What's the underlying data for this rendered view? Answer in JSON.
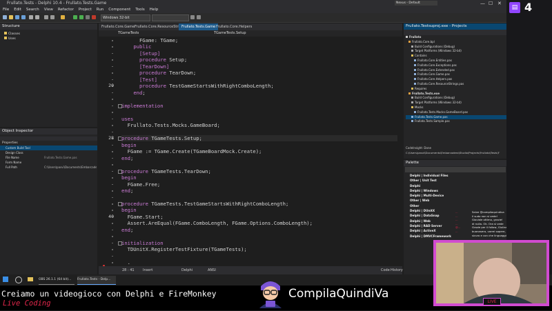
{
  "window": {
    "title": "Frullato.Tests - Delphi 10.4 - Frullato.Tests.Game",
    "controls": [
      "—",
      "☐",
      "✕"
    ]
  },
  "menu": [
    "File",
    "Edit",
    "Search",
    "View",
    "Refactor",
    "Project",
    "Run",
    "Component",
    "Tools",
    "Help"
  ],
  "toolbar": {
    "platform": "Windows 32-bit",
    "layout": "Nexus - Default"
  },
  "structure": {
    "title": "Structure",
    "items": [
      "Classes",
      "Uses"
    ]
  },
  "inspector": {
    "title": "Object Inspector",
    "tab": "Properties",
    "rows": [
      {
        "k": "Custom Build Tool",
        "v": ""
      },
      {
        "k": "Design Class",
        "v": ""
      },
      {
        "k": "File Name",
        "v": "Frullato.Tests.Game.pas"
      },
      {
        "k": "Form Name",
        "v": ""
      },
      {
        "k": "Full Path",
        "v": "C:\\Users\\pasvi\\Documents\\Embarcadero"
      }
    ]
  },
  "editor": {
    "tabs": [
      "Frullato.Core.Game",
      "Frullato.Core.ResourceStrings",
      "Frullato.Tests.Game",
      "Frullato.Core.Helpers"
    ],
    "active_tab": 2,
    "nav_left": "TGameTests",
    "nav_right": "TGameTests.Setup",
    "line_numbers": [
      {
        "n": "20",
        "row": 7
      },
      {
        "n": "28",
        "row": 15
      },
      {
        "n": "40",
        "row": 27
      }
    ],
    "lines": [
      "      FGame: TGame;",
      "    public",
      "      [Setup]",
      "      procedure Setup;",
      "      [TearDown]",
      "      procedure TearDown;",
      "      [Test]",
      "      procedure TestGameStartsWithRightComboLength;",
      "    end;",
      "",
      "implementation",
      "",
      "uses",
      "  Frullato.Tests.Mocks.GameBoard;",
      "",
      "procedure TGameTests.Setup;",
      "begin",
      "  FGame := TGame.Create(TGameBoardMock.Create);",
      "end;",
      "",
      "procedure TGameTests.TearDown;",
      "begin",
      "  FGame.Free;",
      "end;",
      "",
      "procedure TGameTests.TestGameStartsWithRightComboLength;",
      "begin",
      "  FGame.Start;",
      "  Assert.AreEqual(FGame.ComboLength, FGame.Options.ComboLength);",
      "end;",
      "",
      "initialization",
      "  TDUnitX.RegisterTestFixture(TGameTests);",
      "",
      "  ."
    ],
    "status": {
      "pos": "28 : 41",
      "mode": "Insert",
      "encoding": "ANSI",
      "lang": "Delphi",
      "views": [
        "Code",
        "History"
      ]
    }
  },
  "projects": {
    "title": "Frullato.Testsuproj.exe - Projects",
    "items": [
      "Frullato",
      "Frullato.Core.bpl",
      "Build Configurations (Debug)",
      "Target Platforms (Windows 32-bit)",
      "Contains",
      "Frullato.Core.Entities.pas",
      "Frullato.Core.Exceptions.pas",
      "Frullato.Core.Extended.pas",
      "Frullato.Core.Game.pas",
      "Frullato.Core.Helpers.pas",
      "Frullato.Core.ResourceStrings.pas",
      "Requires",
      "Frullato.Tests.exe",
      "Build Configurations (Debug)",
      "Target Platforms (Windows 32-bit)",
      "Mocks",
      "Frullato.Tests.Mocks.GameBoard.pas",
      "Frullato.Tests.Game.pas",
      "Frullato.Tests.Sample.pas"
    ],
    "codesight": "CodeInsight: Done",
    "path": "C:\\Users\\pasvi\\Documents\\Embarcadero\\Studio\\Projects\\Frullato\\Tests\\F"
  },
  "palette": {
    "title": "Palette",
    "items": [
      "Delphi | Individual Files",
      "Other | Unit Test",
      "Delphi",
      "Delphi | Windows",
      "Delphi | Multi-Device",
      "Other | Web",
      "Other",
      "Delphi | DUnitX",
      "Delphi | DataSnap",
      "Delphi | Web",
      "Delphi | RAD Server",
      "Delphi | ActiveX",
      "Delphi | DMVCFramework"
    ]
  },
  "chat": [
    {
      "user": "...",
      "msg": "Salve @compilaquindiva"
    },
    {
      "user": "...",
      "msg": "il sudo non si vede!"
    },
    {
      "user": "...",
      "msg": "Gioviale ottimo, grazie!"
    },
    {
      "user": "...",
      "msg": "di nulla. Ok. Ora si vede"
    },
    {
      "user": "@...",
      "msg": "Grazie per il follow, Giuliana"
    },
    {
      "user": "...",
      "msg": "buonasera, vorrei sapere, stai creando un'app?"
    },
    {
      "user": "",
      "msg": "sicuro e con che linguaggio?"
    }
  ],
  "taskbar": {
    "items": [
      "OBS 26.1.1 (64 bit)...",
      "Frullato.Tests - Delp..."
    ]
  },
  "twitch": {
    "badge": "4"
  },
  "overlay": {
    "line1": "Creiamo un videogioco con Delphi e FireMonkey",
    "line2": "Live Coding",
    "brand": "CompilaQuindiVa",
    "live": "LIVE"
  },
  "colors": {
    "accent": "#1e5a8a",
    "keyword": "#cc7cd7",
    "brand_pink": "#d14bd0",
    "live_red": "#e0264a"
  }
}
